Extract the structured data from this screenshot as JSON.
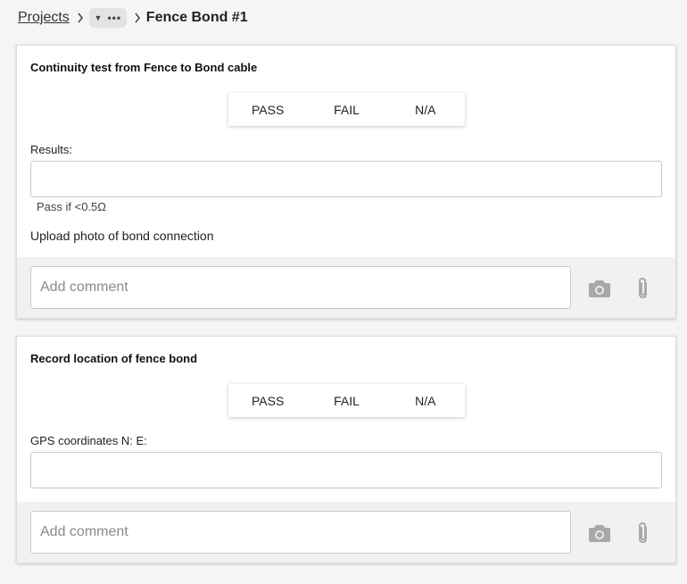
{
  "breadcrumb": {
    "root": "Projects",
    "current": "Fence Bond #1"
  },
  "cards": [
    {
      "title": "Continuity test from Fence to Bond cable",
      "options": [
        "PASS",
        "FAIL",
        "N/A"
      ],
      "field_label": "Results:",
      "field_value": "",
      "hint": "Pass if <0.5Ω",
      "upload_label": "Upload photo of bond connection",
      "comment_placeholder": "Add comment"
    },
    {
      "title": "Record location of fence bond",
      "options": [
        "PASS",
        "FAIL",
        "N/A"
      ],
      "field_label": "GPS coordinates N: E:",
      "field_value": "",
      "comment_placeholder": "Add comment"
    }
  ],
  "icons": {
    "camera": "camera-icon",
    "attach": "paperclip-icon",
    "more": "ellipsis-icon"
  },
  "colors": {
    "background": "#f5f5f5",
    "card": "#ffffff",
    "comment_bar": "#f1f1f1",
    "icon": "#a8a8a8"
  }
}
